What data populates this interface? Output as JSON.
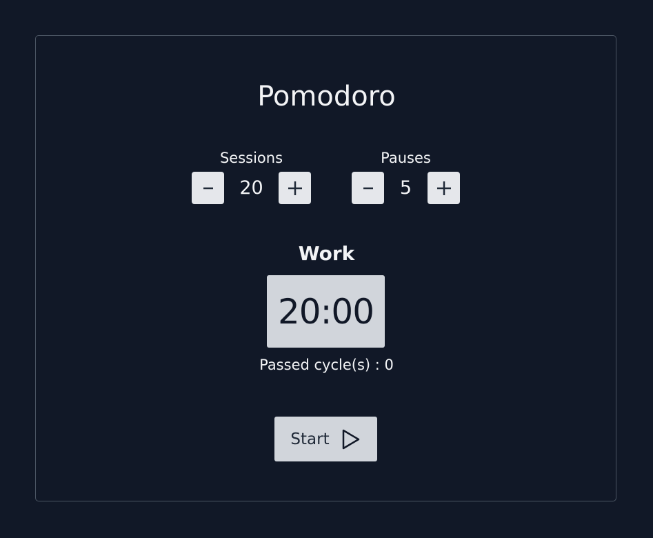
{
  "app": {
    "title": "Pomodoro"
  },
  "sessions": {
    "label": "Sessions",
    "value": "20",
    "decrement_label": "minus-icon",
    "increment_label": "plus-icon"
  },
  "pauses": {
    "label": "Pauses",
    "value": "5",
    "decrement_label": "minus-icon",
    "increment_label": "plus-icon"
  },
  "timer": {
    "mode": "Work",
    "display": "20:00",
    "cycles_text": "Passed cycle(s) : 0"
  },
  "controls": {
    "start_label": "Start",
    "start_icon": "play-icon"
  },
  "colors": {
    "background": "#111827",
    "card_border": "#4b5563",
    "button_bg": "#e5e7eb",
    "timer_bg": "#d1d5db",
    "text_light": "#f3f4f6",
    "text_dark": "#111827"
  }
}
